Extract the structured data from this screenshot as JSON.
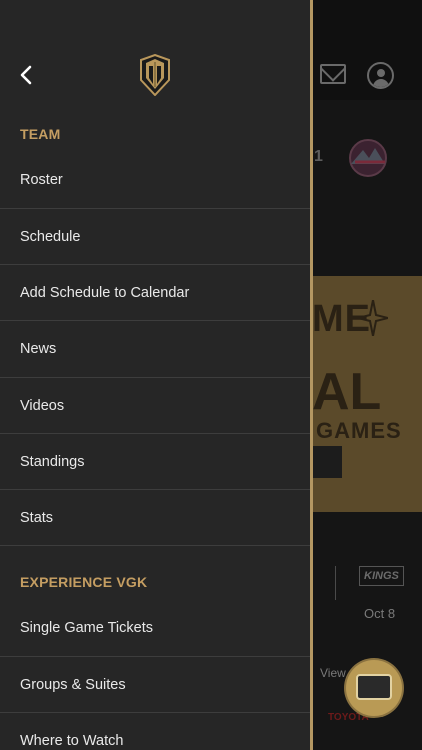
{
  "drawer": {
    "sections": [
      {
        "title": "TEAM",
        "items": [
          {
            "label": "Roster"
          },
          {
            "label": "Schedule"
          },
          {
            "label": "Add Schedule to Calendar"
          },
          {
            "label": "News"
          },
          {
            "label": "Videos"
          },
          {
            "label": "Standings"
          },
          {
            "label": "Stats"
          }
        ]
      },
      {
        "title": "EXPERIENCE VGK",
        "items": [
          {
            "label": "Single Game Tickets"
          },
          {
            "label": "Groups & Suites"
          },
          {
            "label": "Where to Watch"
          }
        ]
      }
    ]
  },
  "background": {
    "score_digit": "1",
    "banner_line1": "ME",
    "banner_line2": "AL",
    "banner_line3": "GAMES",
    "opponent_abbrev": "KINGS",
    "game_date": "Oct 8",
    "view_label": "View",
    "sponsor": "TOYOTA"
  },
  "colors": {
    "accent_gold": "#c59e62",
    "drawer_bg": "#262626",
    "divider": "#3d3d3d"
  },
  "icons": {
    "back": "chevron-left-icon",
    "logo": "golden-knights-helmet-logo",
    "mail": "mail-icon",
    "account": "user-icon"
  }
}
